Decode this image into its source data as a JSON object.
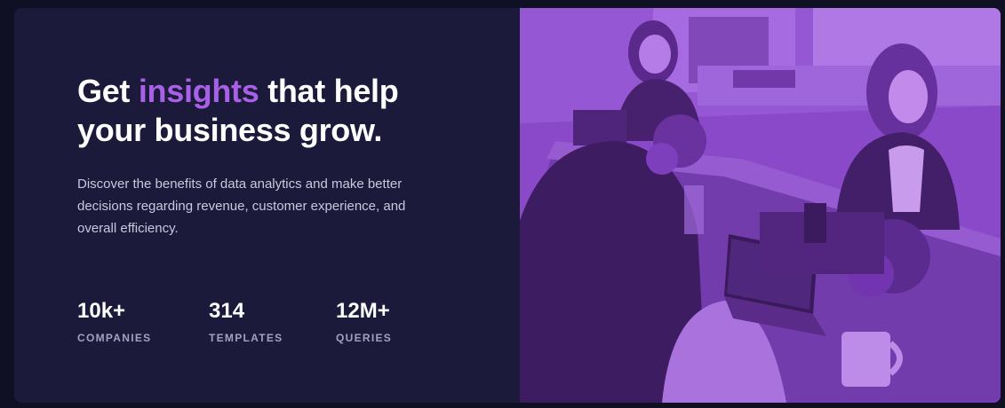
{
  "hero": {
    "headline_pre": "Get ",
    "headline_accent": "insights",
    "headline_post": " that help your business grow.",
    "description": "Discover the benefits of data analytics and make better decisions regarding revenue, customer experience, and overall efficiency."
  },
  "stats": [
    {
      "value": "10k+",
      "label": "COMPANIES"
    },
    {
      "value": "314",
      "label": "TEMPLATES"
    },
    {
      "value": "12M+",
      "label": "QUERIES"
    }
  ],
  "colors": {
    "background": "#0f1024",
    "card": "#1b1a3b",
    "accent": "#a860e6",
    "photo_overlay": "#8a45d0"
  },
  "image": {
    "alt": "People working with laptops at an office table"
  }
}
